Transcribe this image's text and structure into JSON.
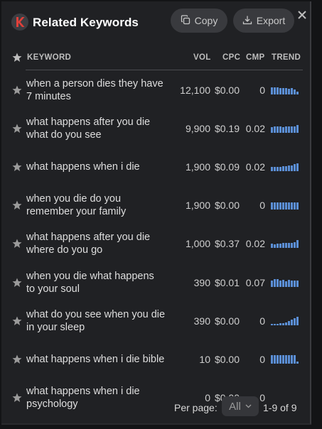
{
  "header": {
    "title": "Related Keywords",
    "copy_label": "Copy",
    "export_label": "Export"
  },
  "table": {
    "columns": [
      "KEYWORD",
      "VOL",
      "CPC",
      "CMP",
      "TREND"
    ],
    "rows": [
      {
        "keyword_lines": [
          "when a person dies they have",
          "7 minutes"
        ],
        "vol": "12,100",
        "cpc": "$0.00",
        "cmp": "0",
        "trend": [
          10,
          10,
          10,
          9,
          9,
          9,
          8,
          9,
          7,
          4
        ]
      },
      {
        "keyword_lines": [
          "what happens after you die",
          "what do you see"
        ],
        "vol": "9,900",
        "cpc": "$0.19",
        "cmp": "0.02",
        "trend": [
          8,
          9,
          9,
          9,
          8,
          9,
          9,
          9,
          9,
          11
        ]
      },
      {
        "keyword_lines": [
          "what happens when i die"
        ],
        "vol": "1,900",
        "cpc": "$0.09",
        "cmp": "0.02",
        "trend": [
          6,
          6,
          6,
          6,
          7,
          7,
          8,
          8,
          10,
          11
        ]
      },
      {
        "keyword_lines": [
          "when you die do you",
          "remember your family"
        ],
        "vol": "1,900",
        "cpc": "$0.00",
        "cmp": "0",
        "trend": [
          10,
          10,
          10,
          10,
          10,
          10,
          10,
          10,
          10,
          10
        ]
      },
      {
        "keyword_lines": [
          "what happens after you die",
          "where do you go"
        ],
        "vol": "1,000",
        "cpc": "$0.37",
        "cmp": "0.02",
        "trend": [
          6,
          5,
          6,
          6,
          7,
          7,
          7,
          7,
          8,
          11
        ]
      },
      {
        "keyword_lines": [
          "when you die what happens",
          "to your soul"
        ],
        "vol": "390",
        "cpc": "$0.01",
        "cmp": "0.07",
        "trend": [
          9,
          11,
          11,
          9,
          10,
          8,
          10,
          9,
          9,
          9
        ]
      },
      {
        "keyword_lines": [
          "what do you see when you die",
          "in your sleep"
        ],
        "vol": "390",
        "cpc": "$0.00",
        "cmp": "0",
        "trend": [
          2,
          2,
          2,
          3,
          3,
          4,
          6,
          8,
          10,
          12
        ]
      },
      {
        "keyword_lines": [
          "what happens when i die bible"
        ],
        "vol": "10",
        "cpc": "$0.00",
        "cmp": "0",
        "trend": [
          12,
          12,
          12,
          12,
          12,
          12,
          12,
          12,
          12,
          3
        ]
      },
      {
        "keyword_lines": [
          "what happens when i die",
          "psychology"
        ],
        "vol": "0",
        "cpc": "$0.00",
        "cmp": "0",
        "trend": []
      }
    ]
  },
  "footer": {
    "per_page_label": "Per page:",
    "per_page_value": "All",
    "range_text": "1-9 of 9"
  },
  "colors": {
    "background": "#202124",
    "accent_logo": "#e0403a",
    "trend_bar": "#5b8fd6",
    "button_bg": "#393a3e"
  },
  "icons": [
    "k-logo-icon",
    "copy-icon",
    "export-icon",
    "close-icon",
    "star-icon",
    "chevron-down-icon"
  ]
}
